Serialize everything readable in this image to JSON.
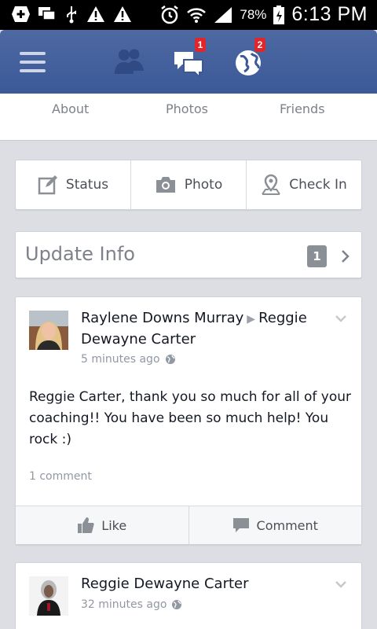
{
  "status_bar": {
    "battery_percent": "78%",
    "time": "6:13 PM",
    "icons": [
      "add-icon",
      "chat-icon",
      "usb-icon",
      "warning-icon",
      "warning-icon",
      "alarm-icon",
      "wifi-icon",
      "signal-icon",
      "battery-charging-icon"
    ]
  },
  "navbar": {
    "messages_badge": "1",
    "notifications_badge": "2",
    "icons": [
      "menu-icon",
      "friend-requests-icon",
      "messages-icon",
      "notifications-globe-icon"
    ],
    "color": "#3b5998"
  },
  "tabs": [
    {
      "label": "About"
    },
    {
      "label": "Photos"
    },
    {
      "label": "Friends"
    }
  ],
  "composer": {
    "status_label": "Status",
    "photo_label": "Photo",
    "checkin_label": "Check In"
  },
  "update_info": {
    "title": "Update Info",
    "count": "1"
  },
  "posts": [
    {
      "author": "Raylene Downs Murray",
      "target": "Reggie Dewayne Carter",
      "time": "5 minutes ago",
      "mention": "Reggie Carter",
      "body": ", thank you so much for all of your coaching!! You have been so much help! You rock :)",
      "comments": "1 comment",
      "like_label": "Like",
      "comment_label": "Comment"
    },
    {
      "author": "Reggie Dewayne Carter",
      "time": "32 minutes ago"
    }
  ]
}
